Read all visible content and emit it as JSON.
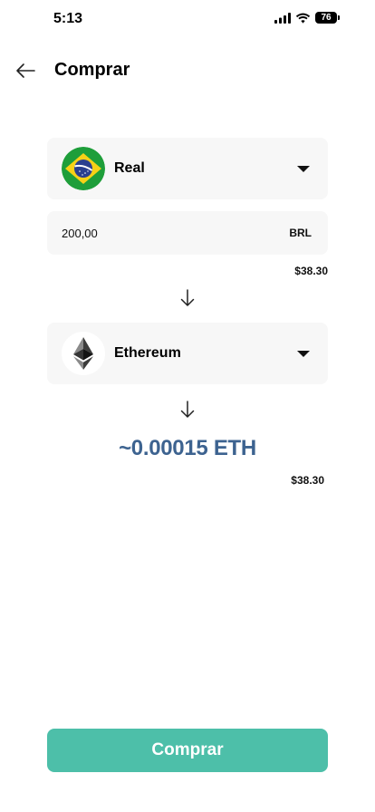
{
  "status_bar": {
    "time": "5:13",
    "battery": "76",
    "icons": [
      "signal-icon",
      "wifi-icon",
      "battery-icon"
    ]
  },
  "header": {
    "back_icon": "arrow-left-icon",
    "title": "Comprar"
  },
  "from_currency": {
    "flag_icon": "brazil-flag-icon",
    "name": "Real",
    "dropdown_icon": "caret-down-icon"
  },
  "amount": {
    "value": "200,00",
    "unit": "BRL",
    "usd_value": "$38.30"
  },
  "convert_icon": "arrow-down-icon",
  "to_currency": {
    "logo_icon": "ethereum-logo-icon",
    "name": "Ethereum",
    "dropdown_icon": "caret-down-icon"
  },
  "result": {
    "amount": "~0.00015 ETH",
    "usd_value": "$38.30"
  },
  "buy_button": {
    "label": "Comprar"
  },
  "colors": {
    "accent": "#4dbfa9",
    "result_text": "#3d6390",
    "card_background": "#f7f7f7"
  }
}
